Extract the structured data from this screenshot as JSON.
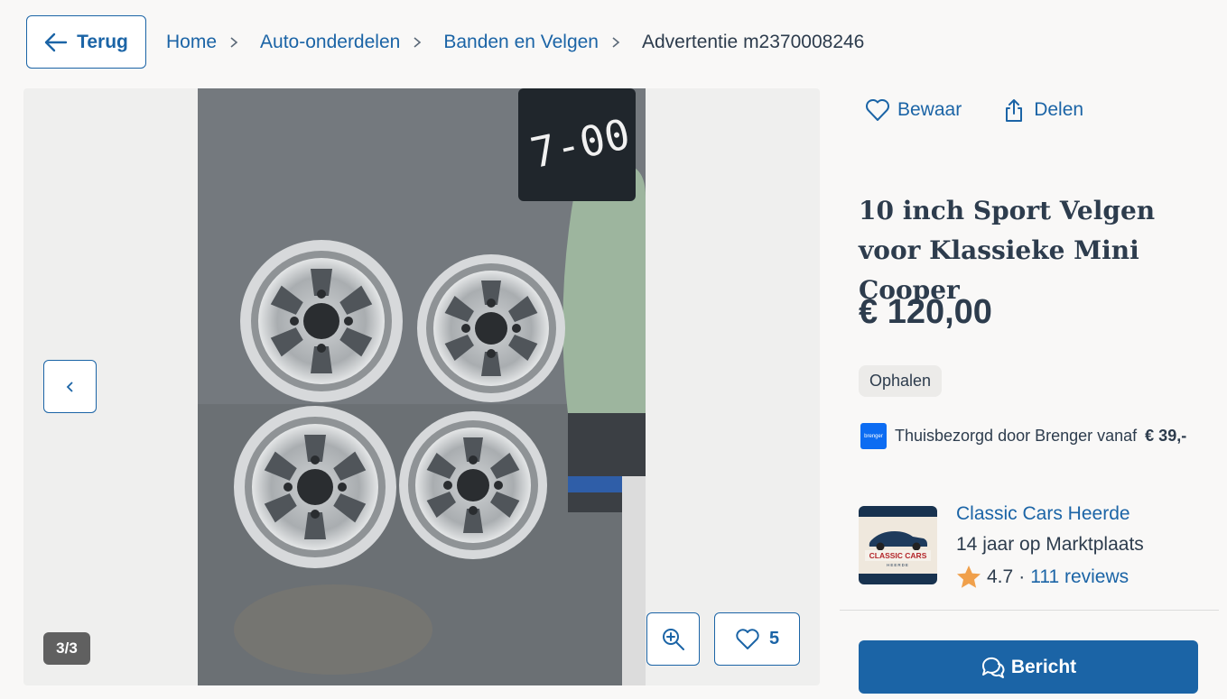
{
  "nav": {
    "back_label": "Terug",
    "breadcrumbs": [
      "Home",
      "Auto-onderdelen",
      "Banden en Velgen"
    ],
    "current": "Advertentie m2370008246"
  },
  "gallery": {
    "counter": "3/3",
    "favorites_count": "5"
  },
  "actions": {
    "save_label": "Bewaar",
    "share_label": "Delen"
  },
  "listing": {
    "title": "10 inch Sport Velgen voor Klassieke Mini Cooper",
    "price": "€ 120,00",
    "badge": "Ophalen",
    "delivery_text": "Thuisbezorgd door Brenger vanaf",
    "delivery_price": "€ 39,-",
    "delivery_logo": "brenger"
  },
  "seller": {
    "name": "Classic Cars Heerde",
    "years": "14 jaar op Marktplaats",
    "rating": "4.7",
    "rating_sep": "·",
    "reviews": "111 reviews",
    "logo_text": "CLASSIC CARS",
    "logo_subtext": "HEERDE"
  },
  "cta": {
    "message_label": "Bericht"
  },
  "colors": {
    "primary": "#1b64a6",
    "text": "#2d3c4d",
    "star": "#f0a04b"
  }
}
